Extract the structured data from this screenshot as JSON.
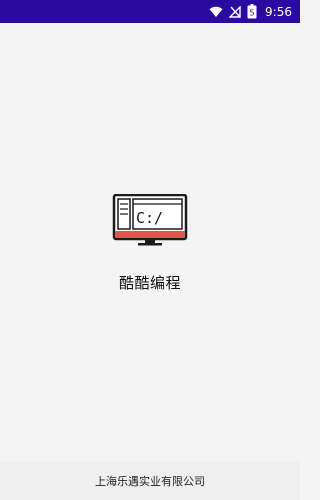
{
  "status_bar": {
    "time": "9:56",
    "battery_level": "5",
    "icons": [
      "wifi-icon",
      "signal-icon",
      "battery-icon"
    ],
    "background_color": "#2a0aa0"
  },
  "splash": {
    "logo_icon": "computer-terminal-icon",
    "logo_text": "C:/",
    "app_name": "酷酷编程",
    "logo_accent_color": "#d9574f"
  },
  "footer": {
    "company": "上海乐遇实业有限公司"
  }
}
